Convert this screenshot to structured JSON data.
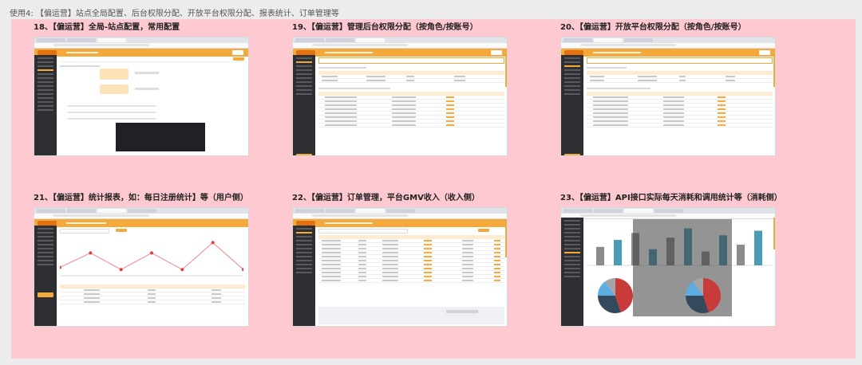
{
  "header": {
    "text": "使用4: 【偏运营】站点全局配置、后台权限分配、开放平台权限分配、报表统计、订单管理等"
  },
  "cards": [
    {
      "title": "18、【偏运营】全局-站点配置，常用配置"
    },
    {
      "title": "19、【偏运营】管理后台权限分配（按角色/按账号）"
    },
    {
      "title": "20、【偏运营】开放平台权限分配（按角色/按账号）"
    },
    {
      "title": "21、【偏运营】统计报表，如：每日注册统计】等（用户侧）"
    },
    {
      "title": "22、【偏运营】订单管理，平台GMV收入（收入侧）"
    },
    {
      "title": "23、【偏运营】API接口实际每天消耗和调用统计等（消耗侧）"
    }
  ],
  "colors": {
    "accent": "#f6a93b",
    "sidebar": "#2e2f33",
    "board": "#ffc9d1"
  },
  "chart_line": {
    "type": "line",
    "values": [
      20,
      55,
      15,
      55,
      15,
      80,
      15
    ]
  },
  "chart_bars": {
    "type": "bar",
    "values": [
      40,
      55,
      70,
      35,
      60,
      80,
      30,
      65,
      45,
      75
    ]
  },
  "chart_pie": {
    "type": "pie",
    "values": [
      45,
      30,
      15,
      10
    ]
  }
}
